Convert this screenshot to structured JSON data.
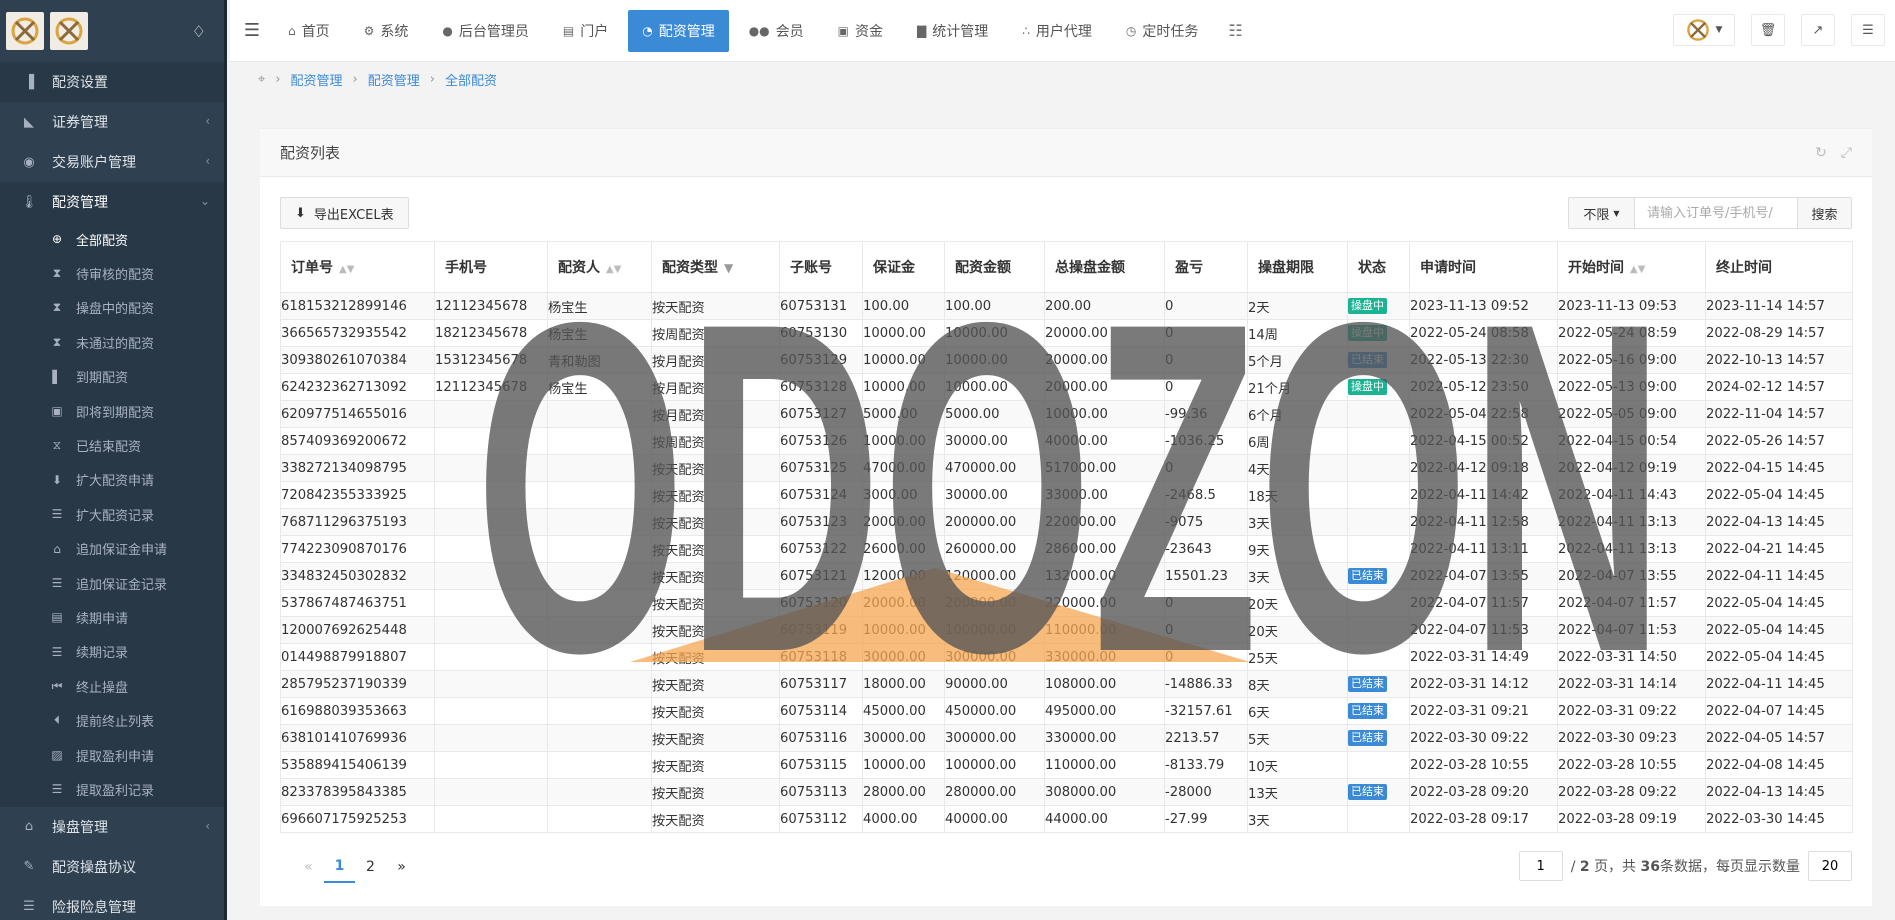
{
  "sidebar": {
    "items": [
      {
        "label": "配资设置",
        "icon": "signal-icon"
      },
      {
        "label": "证券管理",
        "icon": "area-chart-icon"
      },
      {
        "label": "交易账户管理",
        "icon": "user-circle-icon"
      },
      {
        "label": "配资管理",
        "icon": "thermometer-icon"
      }
    ],
    "sub_items": [
      {
        "label": "全部配资",
        "icon": "life-ring-icon"
      },
      {
        "label": "待审核的配资",
        "icon": "hourglass-icon"
      },
      {
        "label": "操盘中的配资",
        "icon": "hourglass-half-icon"
      },
      {
        "label": "未通过的配资",
        "icon": "hourglass-end-icon"
      },
      {
        "label": "到期配资",
        "icon": "step-icon"
      },
      {
        "label": "即将到期配资",
        "icon": "camera-icon"
      },
      {
        "label": "已结束配资",
        "icon": "hourglass-o-icon"
      },
      {
        "label": "扩大配资申请",
        "icon": "stamp-icon"
      },
      {
        "label": "扩大配资记录",
        "icon": "list-icon"
      },
      {
        "label": "追加保证金申请",
        "icon": "bank-icon"
      },
      {
        "label": "追加保证金记录",
        "icon": "list-icon"
      },
      {
        "label": "续期申请",
        "icon": "file-icon"
      },
      {
        "label": "续期记录",
        "icon": "list-icon"
      },
      {
        "label": "终止操盘",
        "icon": "fast-backward-icon"
      },
      {
        "label": "提前终止列表",
        "icon": "step-backward-icon"
      },
      {
        "label": "提取盈利申请",
        "icon": "save-icon"
      },
      {
        "label": "提取盈利记录",
        "icon": "list-icon"
      }
    ],
    "bottom_items": [
      {
        "label": "操盘管理",
        "icon": "bank-icon"
      },
      {
        "label": "配资操盘协议",
        "icon": "pencil-icon"
      },
      {
        "label": "险报险息管理",
        "icon": "list-icon"
      }
    ]
  },
  "topnav": {
    "tabs": [
      {
        "label": "首页",
        "icon": "home-icon"
      },
      {
        "label": "系统",
        "icon": "gear-icon"
      },
      {
        "label": "后台管理员",
        "icon": "user-icon"
      },
      {
        "label": "门户",
        "icon": "newspaper-icon"
      },
      {
        "label": "配资管理",
        "icon": "pie-chart-icon"
      },
      {
        "label": "会员",
        "icon": "users-icon"
      },
      {
        "label": "资金",
        "icon": "money-icon"
      },
      {
        "label": "统计管理",
        "icon": "bar-chart-icon"
      },
      {
        "label": "用户代理",
        "icon": "sitemap-icon"
      },
      {
        "label": "定时任务",
        "icon": "clock-icon"
      }
    ]
  },
  "breadcrumb": [
    "配资管理",
    "配资管理",
    "全部配资"
  ],
  "panel": {
    "title": "配资列表",
    "export_label": "导出EXCEL表",
    "filter_value": "不限",
    "search_placeholder": "请输入订单号/手机号/",
    "search_label": "搜索"
  },
  "table": {
    "headers": [
      "订单号",
      "手机号",
      "配资人",
      "配资类型",
      "子账号",
      "保证金",
      "配资金额",
      "总操盘金额",
      "盈亏",
      "操盘期限",
      "状态",
      "申请时间",
      "开始时间",
      "终止时间"
    ],
    "rows": [
      [
        "618153212899146",
        "12112345678",
        "杨宝生",
        "按天配资",
        "60753131",
        "100.00",
        "100.00",
        "200.00",
        "0",
        "2天",
        "操盘中",
        "2023-11-13 09:52",
        "2023-11-13 09:53",
        "2023-11-14 14:57"
      ],
      [
        "366565732935542",
        "18212345678",
        "杨宝生",
        "按周配资",
        "60753130",
        "10000.00",
        "10000.00",
        "20000.00",
        "0",
        "14周",
        "操盘中",
        "2022-05-24 08:58",
        "2022-05-24 08:59",
        "2022-08-29 14:57"
      ],
      [
        "309380261070384",
        "15312345678",
        "青和勒图",
        "按月配资",
        "60753129",
        "10000.00",
        "10000.00",
        "20000.00",
        "0",
        "5个月",
        "已结束",
        "2022-05-13 22:30",
        "2022-05-16 09:00",
        "2022-10-13 14:57"
      ],
      [
        "624232362713092",
        "12112345678",
        "杨宝生",
        "按月配资",
        "60753128",
        "10000.00",
        "10000.00",
        "20000.00",
        "0",
        "21个月",
        "操盘中",
        "2022-05-12 23:50",
        "2022-05-13 09:00",
        "2024-02-12 14:57"
      ],
      [
        "620977514655016",
        "",
        "",
        "按月配资",
        "60753127",
        "5000.00",
        "5000.00",
        "10000.00",
        "-99.36",
        "6个月",
        "",
        "2022-05-04 22:58",
        "2022-05-05 09:00",
        "2022-11-04 14:57"
      ],
      [
        "857409369200672",
        "",
        "",
        "按周配资",
        "60753126",
        "10000.00",
        "30000.00",
        "40000.00",
        "-1036.25",
        "6周",
        "",
        "2022-04-15 00:52",
        "2022-04-15 00:54",
        "2022-05-26 14:57"
      ],
      [
        "338272134098795",
        "",
        "",
        "按天配资",
        "60753125",
        "47000.00",
        "470000.00",
        "517000.00",
        "0",
        "4天",
        "",
        "2022-04-12 09:18",
        "2022-04-12 09:19",
        "2022-04-15 14:45"
      ],
      [
        "720842355333925",
        "",
        "",
        "按天配资",
        "60753124",
        "3000.00",
        "30000.00",
        "33000.00",
        "-2468.5",
        "18天",
        "",
        "2022-04-11 14:42",
        "2022-04-11 14:43",
        "2022-05-04 14:45"
      ],
      [
        "768711296375193",
        "",
        "",
        "按天配资",
        "60753123",
        "20000.00",
        "200000.00",
        "220000.00",
        "-9075",
        "3天",
        "",
        "2022-04-11 12:58",
        "2022-04-11 13:13",
        "2022-04-13 14:45"
      ],
      [
        "774223090870176",
        "",
        "",
        "按天配资",
        "60753122",
        "26000.00",
        "260000.00",
        "286000.00",
        "-23643",
        "9天",
        "",
        "2022-04-11 13:11",
        "2022-04-11 13:13",
        "2022-04-21 14:45"
      ],
      [
        "334832450302832",
        "",
        "",
        "按天配资",
        "60753121",
        "12000.00",
        "120000.00",
        "132000.00",
        "15501.23",
        "3天",
        "已结束",
        "2022-04-07 13:55",
        "2022-04-07 13:55",
        "2022-04-11 14:45"
      ],
      [
        "537867487463751",
        "",
        "",
        "按天配资",
        "60753120",
        "20000.00",
        "200000.00",
        "220000.00",
        "0",
        "20天",
        "",
        "2022-04-07 11:57",
        "2022-04-07 11:57",
        "2022-05-04 14:45"
      ],
      [
        "120007692625448",
        "",
        "",
        "按天配资",
        "60753119",
        "10000.00",
        "100000.00",
        "110000.00",
        "0",
        "20天",
        "",
        "2022-04-07 11:53",
        "2022-04-07 11:53",
        "2022-05-04 14:45"
      ],
      [
        "014498879918807",
        "",
        "",
        "按天配资",
        "60753118",
        "30000.00",
        "300000.00",
        "330000.00",
        "0",
        "25天",
        "",
        "2022-03-31 14:49",
        "2022-03-31 14:50",
        "2022-05-04 14:45"
      ],
      [
        "285795237190339",
        "",
        "",
        "按天配资",
        "60753117",
        "18000.00",
        "90000.00",
        "108000.00",
        "-14886.33",
        "8天",
        "已结束",
        "2022-03-31 14:12",
        "2022-03-31 14:14",
        "2022-04-11 14:45"
      ],
      [
        "616988039353663",
        "",
        "",
        "按天配资",
        "60753114",
        "45000.00",
        "450000.00",
        "495000.00",
        "-32157.61",
        "6天",
        "已结束",
        "2022-03-31 09:21",
        "2022-03-31 09:22",
        "2022-04-07 14:45"
      ],
      [
        "638101410769936",
        "",
        "",
        "按天配资",
        "60753116",
        "30000.00",
        "300000.00",
        "330000.00",
        "2213.57",
        "5天",
        "已结束",
        "2022-03-30 09:22",
        "2022-03-30 09:23",
        "2022-04-05 14:57"
      ],
      [
        "535889415406139",
        "",
        "",
        "按天配资",
        "60753115",
        "10000.00",
        "100000.00",
        "110000.00",
        "-8133.79",
        "10天",
        "",
        "2022-03-28 10:55",
        "2022-03-28 10:55",
        "2022-04-08 14:45"
      ],
      [
        "823378395843385",
        "",
        "",
        "按天配资",
        "60753113",
        "28000.00",
        "280000.00",
        "308000.00",
        "-28000",
        "13天",
        "已结束",
        "2022-03-28 09:20",
        "2022-03-28 09:22",
        "2022-04-13 14:45"
      ],
      [
        "696607175925253",
        "",
        "",
        "按天配资",
        "60753112",
        "4000.00",
        "40000.00",
        "44000.00",
        "-27.99",
        "3天",
        "",
        "2022-03-28 09:17",
        "2022-03-28 09:19",
        "2022-03-30 14:45"
      ]
    ]
  },
  "pagination": {
    "prev": "«",
    "pages": [
      "1",
      "2"
    ],
    "next": "»",
    "current_page": "1",
    "info_prefix": "/",
    "total_pages": "2",
    "info_mid": "页，共",
    "total_rows": "36",
    "info_suffix": "条数据，每页显示数量",
    "page_size": "20"
  },
  "watermark": {
    "text": "ODOZON",
    "color": "#555555",
    "accent": "#f5a650"
  },
  "colors": {
    "accent": "#3b8ad6",
    "sidebar": "#2f4050",
    "green_badge": "#1ab394",
    "blue_badge": "#3b8ad6"
  }
}
